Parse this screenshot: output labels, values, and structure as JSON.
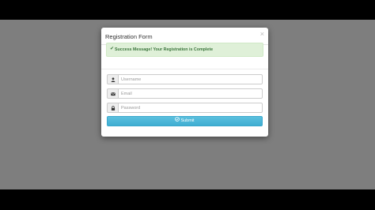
{
  "modal": {
    "title": "Registration Form",
    "close_symbol": "×"
  },
  "alert": {
    "icon": "check-icon",
    "icon_glyph": "✔",
    "text": "Success Message! Your Registration is Complete",
    "color": "#3c763d",
    "background": "#dff0d8"
  },
  "fields": {
    "username": {
      "placeholder": "Username",
      "value": "",
      "icon": "user-icon"
    },
    "email": {
      "placeholder": "Email",
      "value": "",
      "icon": "envelope-icon"
    },
    "password": {
      "placeholder": "Password",
      "value": "",
      "icon": "lock-icon"
    }
  },
  "submit": {
    "label": "Submit",
    "icon": "circle-check-icon",
    "color": "#5bc0de"
  }
}
